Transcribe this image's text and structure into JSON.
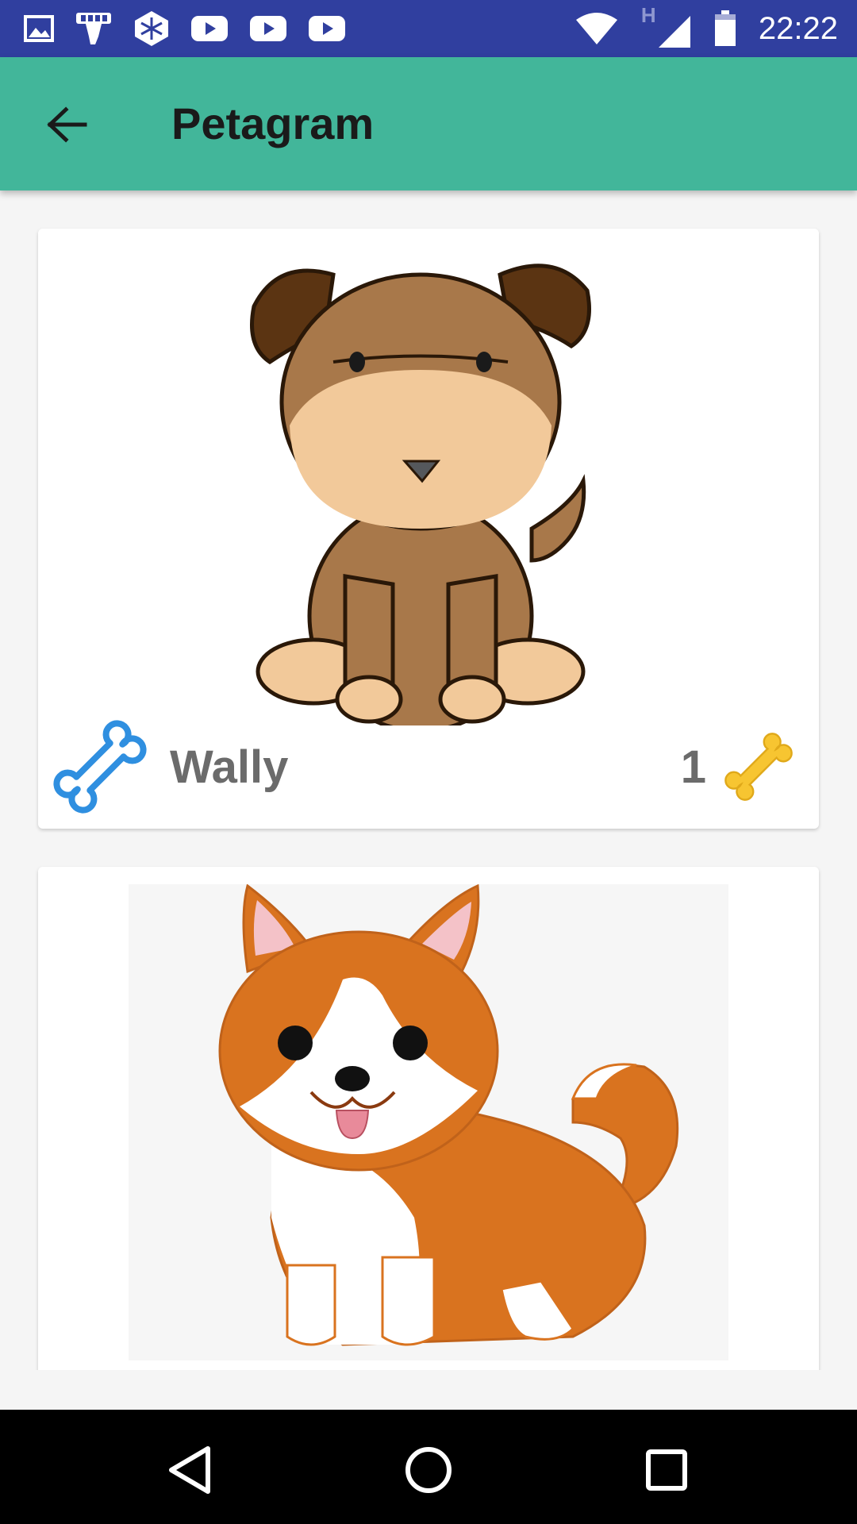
{
  "status_bar": {
    "time": "22:22",
    "network_label": "H",
    "left_icons": [
      "image-icon",
      "fist-icon",
      "app-logo-icon",
      "youtube-icon",
      "youtube-icon",
      "youtube-icon"
    ],
    "right_icons": [
      "wifi-icon",
      "signal-icon",
      "battery-icon"
    ]
  },
  "app_bar": {
    "title": "Petagram",
    "back_icon": "arrow-left-icon",
    "color": "#42b69a"
  },
  "pets": [
    {
      "name": "Wally",
      "rating": "1",
      "image": "brown-puppy-illustration",
      "like_icon": "bone-outline-icon",
      "rating_icon": "bone-filled-icon"
    },
    {
      "name": "",
      "rating": "",
      "image": "corgi-puppy-illustration",
      "like_icon": "bone-outline-icon",
      "rating_icon": "bone-filled-icon"
    }
  ],
  "colors": {
    "status_bar": "#303f9f",
    "accent_bone_blue": "#2f8fe0",
    "accent_bone_yellow": "#f7c531"
  },
  "nav_bar": {
    "buttons": [
      "back-triangle-icon",
      "home-circle-icon",
      "recents-square-icon"
    ]
  }
}
